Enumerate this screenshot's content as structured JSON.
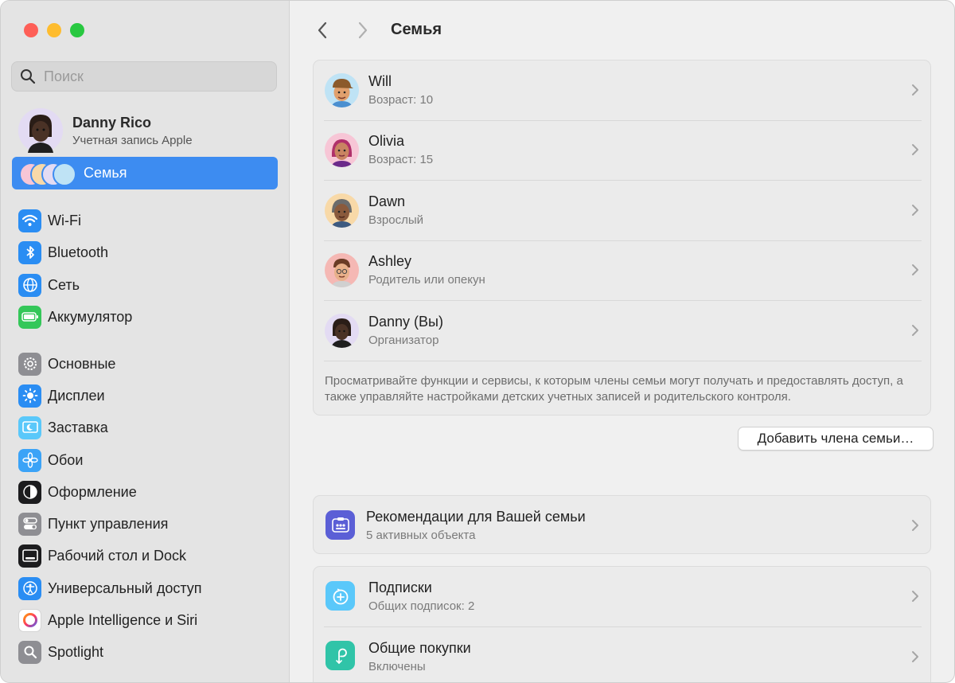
{
  "window": {
    "title": "Семья"
  },
  "sidebar": {
    "search_placeholder": "Поиск",
    "account": {
      "name": "Danny Rico",
      "subtitle": "Учетная запись Apple"
    },
    "family_label": "Семья",
    "items": [
      {
        "label": "Wi-Fi",
        "icon": "wifi-icon",
        "color": "#2a8df3"
      },
      {
        "label": "Bluetooth",
        "icon": "bluetooth-icon",
        "color": "#2a8df3"
      },
      {
        "label": "Сеть",
        "icon": "globe-icon",
        "color": "#2a8df3"
      },
      {
        "label": "Аккумулятор",
        "icon": "battery-icon",
        "color": "#34c759"
      },
      {
        "label": "Основные",
        "icon": "gear-icon",
        "color": "#8e8e93"
      },
      {
        "label": "Дисплеи",
        "icon": "sun-icon",
        "color": "#2a8df3"
      },
      {
        "label": "Заставка",
        "icon": "screensaver-icon",
        "color": "#5ac8fa"
      },
      {
        "label": "Обои",
        "icon": "flower-icon",
        "color": "#3ba3f7"
      },
      {
        "label": "Оформление",
        "icon": "appearance-icon",
        "color": "#1c1c1e"
      },
      {
        "label": "Пункт управления",
        "icon": "toggles-icon",
        "color": "#8e8e93"
      },
      {
        "label": "Рабочий стол и Dock",
        "icon": "dock-icon",
        "color": "#1c1c1e"
      },
      {
        "label": "Универсальный доступ",
        "icon": "accessibility-icon",
        "color": "#2a8df3"
      },
      {
        "label": "Apple Intelligence и Siri",
        "icon": "siri-icon",
        "color": "#ffffff"
      },
      {
        "label": "Spotlight",
        "icon": "magnifier-icon",
        "color": "#8e8e93"
      }
    ]
  },
  "main": {
    "members": [
      {
        "name": "Will",
        "role": "Возраст: 10",
        "avatar_bg": "#bfe3f5"
      },
      {
        "name": "Olivia",
        "role": "Возраст: 15",
        "avatar_bg": "#f7c6d6"
      },
      {
        "name": "Dawn",
        "role": "Взрослый",
        "avatar_bg": "#f8d9a8"
      },
      {
        "name": "Ashley",
        "role": "Родитель или опекун",
        "avatar_bg": "#f5b8b4"
      },
      {
        "name": "Danny (Вы)",
        "role": "Организатор",
        "avatar_bg": "#e3dbf3"
      }
    ],
    "description": "Просматривайте функции и сервисы, к которым члены семьи могут получать и предоставлять доступ, а также управляйте настройками детских учетных записей и родительского контроля.",
    "add_member_button": "Добавить члена семьи…",
    "recommendations": {
      "title": "Рекомендации для Вашей семьи",
      "subtitle": "5 активных объекта"
    },
    "subscriptions": {
      "title": "Подписки",
      "subtitle": "Общих подписок: 2"
    },
    "purchases": {
      "title": "Общие покупки",
      "subtitle": "Включены"
    }
  }
}
